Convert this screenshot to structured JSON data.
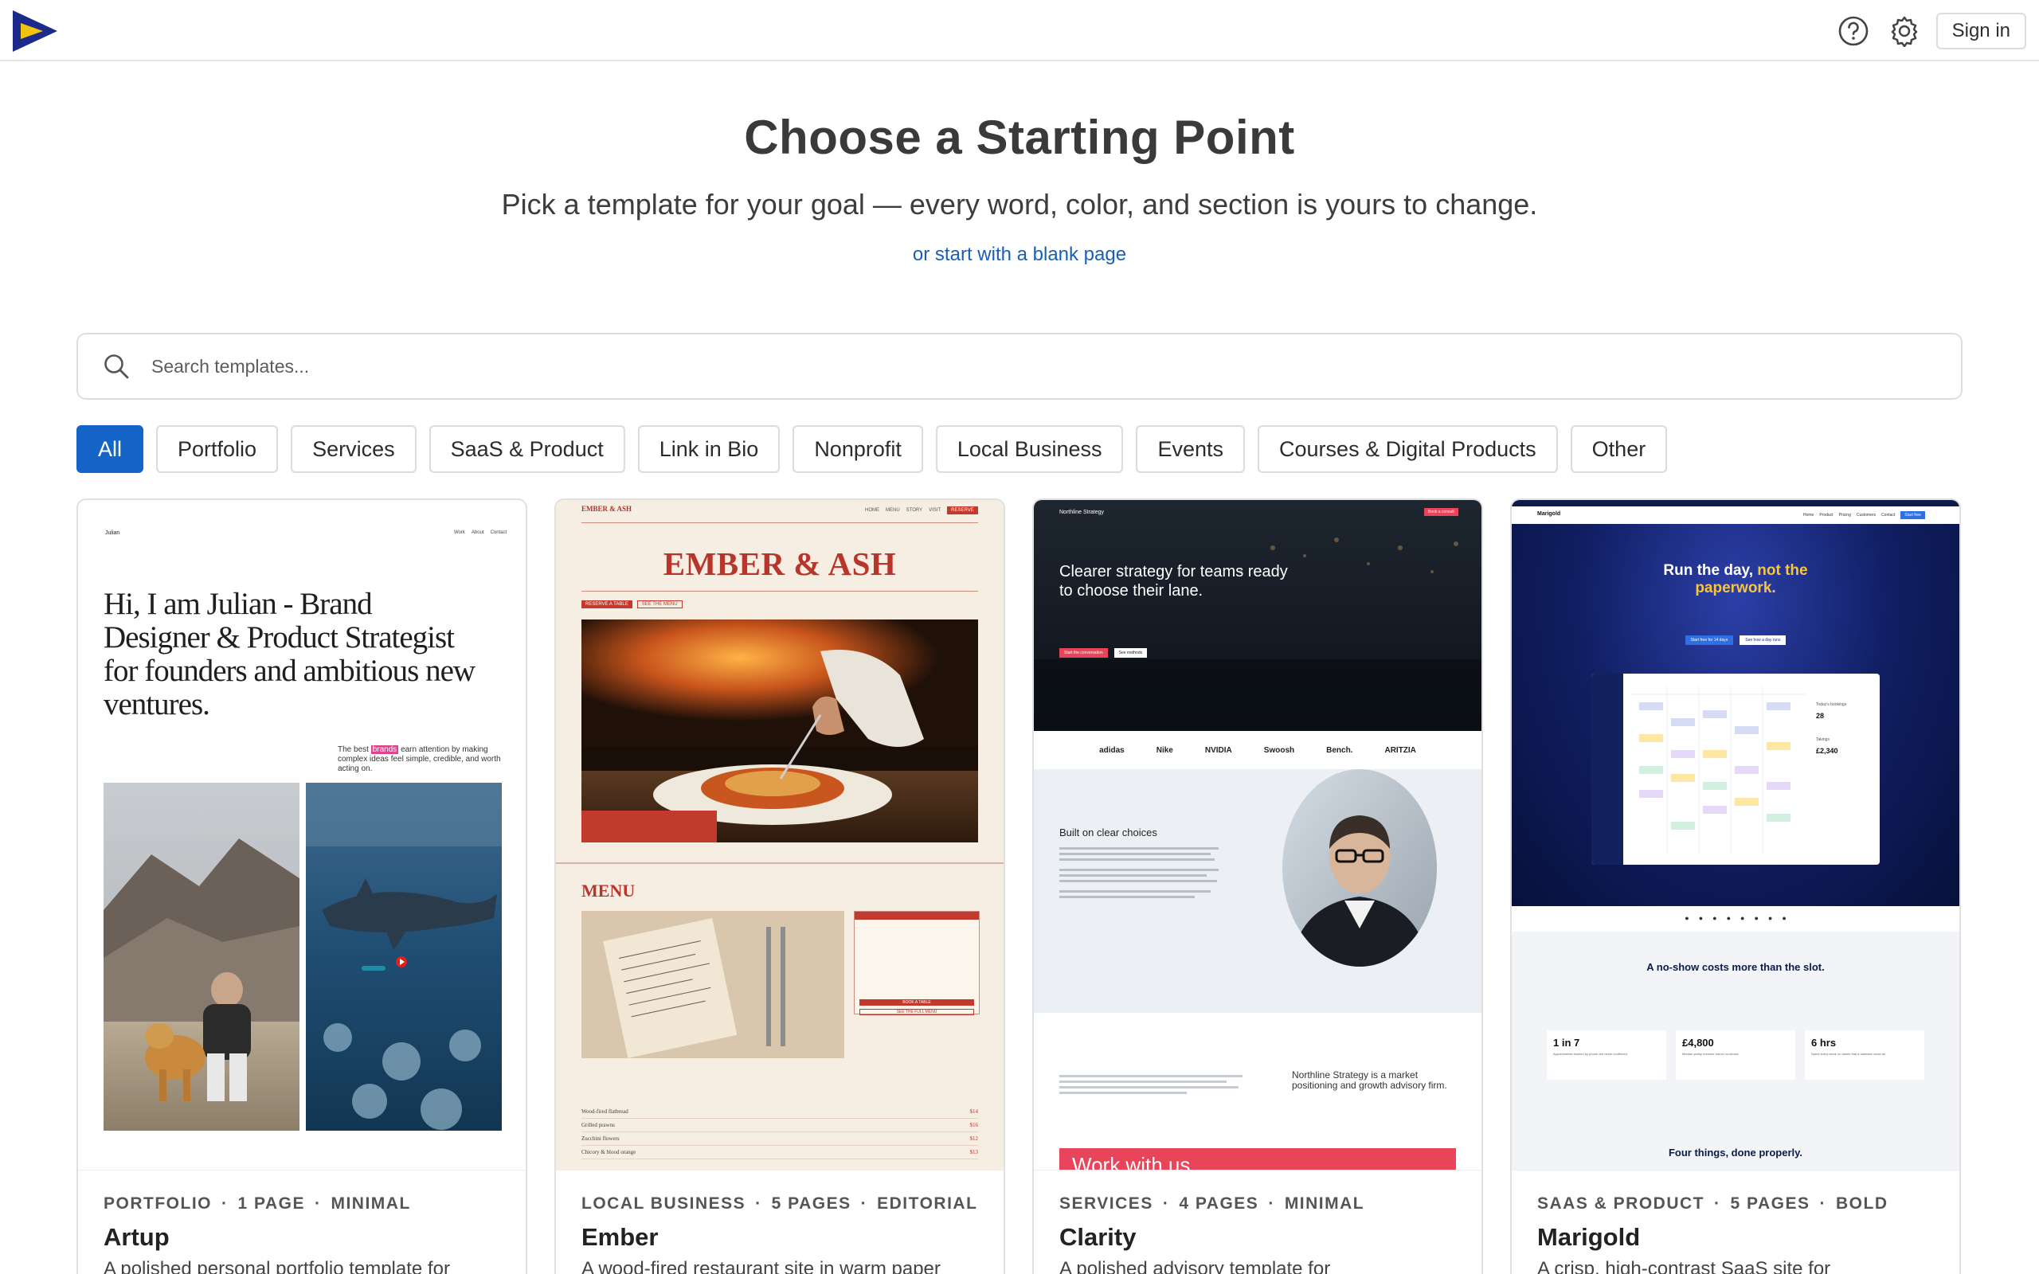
{
  "header": {
    "sign_in_label": "Sign in"
  },
  "hero": {
    "title": "Choose a Starting Point",
    "subtitle": "Pick a template for your goal — every word, color, and section is yours to change.",
    "blank_link": "or start with a blank page"
  },
  "search": {
    "placeholder": "Search templates..."
  },
  "filters": [
    "All",
    "Portfolio",
    "Services",
    "SaaS & Product",
    "Link in Bio",
    "Nonprofit",
    "Local Business",
    "Events",
    "Courses & Digital Products",
    "Other"
  ],
  "active_filter": "All",
  "cards": [
    {
      "category": "PORTFOLIO",
      "pages": "1 PAGE",
      "style": "MINIMAL",
      "name": "Artup",
      "description": "A polished personal portfolio template for",
      "preview": {
        "brand": "Julian",
        "nav": [
          "Work",
          "About",
          "Contact"
        ],
        "headline": "Hi, I am Julian - Brand Designer & Product Strategist for founders and ambitious new ventures.",
        "blurb_before": "The best",
        "blurb_highlight": "brands",
        "blurb_after": "earn attention by making complex ideas feel simple, credible, and worth acting on."
      }
    },
    {
      "category": "LOCAL BUSINESS",
      "pages": "5 PAGES",
      "style": "EDITORIAL",
      "name": "Ember",
      "description": "A wood-fired restaurant site in warm paper",
      "preview": {
        "brand": "EMBER & ASH",
        "nav": [
          "HOME",
          "MENU",
          "STORY",
          "VISIT"
        ],
        "nav_cta": "RESERVE",
        "hero_title": "EMBER & ASH",
        "tags": [
          "RESERVE A TABLE",
          "SEE THE MENU"
        ],
        "menu_title": "MENU",
        "card_button": "BOOK A TABLE",
        "card_link": "SEE THE FULL MENU",
        "menu_items": [
          {
            "name": "Wood-fired flatbread",
            "price": "$14"
          },
          {
            "name": "Grilled prawns",
            "price": "$16"
          },
          {
            "name": "Zucchini flowers",
            "price": "$12"
          },
          {
            "name": "Chicory & blood orange",
            "price": "$13"
          }
        ]
      }
    },
    {
      "category": "SERVICES",
      "pages": "4 PAGES",
      "style": "MINIMAL",
      "name": "Clarity",
      "description": "A polished advisory template for",
      "preview": {
        "brand": "Northline Strategy",
        "cta": "Book a consult",
        "headline": "Clearer strategy for teams ready to choose their lane.",
        "btn_primary": "Start the conversation",
        "btn_secondary": "See methods",
        "logos": [
          "adidas",
          "Nike",
          "NVIDIA",
          "Swoosh",
          "Bench.",
          "ARITZIA"
        ],
        "section_title": "Built on clear choices",
        "about": "Northline Strategy is a market positioning and growth advisory firm.",
        "banner": "Work with us"
      }
    },
    {
      "category": "SAAS & PRODUCT",
      "pages": "5 PAGES",
      "style": "BOLD",
      "name": "Marigold",
      "description": "A crisp, high-contrast SaaS site for",
      "preview": {
        "brand": "Marigold",
        "nav": [
          "Home",
          "Product",
          "Pricing",
          "Customers",
          "Contact"
        ],
        "nav_cta": "Start free",
        "headline_white": "Run the day, ",
        "headline_yellow": "not the",
        "headline_yellow2": "paperwork.",
        "btn_primary": "Start free for 14 days",
        "btn_secondary": "See how a day runs",
        "section_title": "A no-show costs more than the slot.",
        "stats": [
          {
            "value": "1 in 7",
            "label": "Appointments booked by phone are never confirmed"
          },
          {
            "value": "£4,800",
            "label": "Median yearly revenue lost to no-shows"
          },
          {
            "value": "6 hrs",
            "label": "Spent every week on admin that a calendar could do"
          }
        ],
        "bottom_title": "Four things, done properly.",
        "dash_stats": [
          {
            "label": "Today's bookings",
            "value": "28"
          },
          {
            "label": "Takings",
            "value": "£2,340"
          }
        ]
      }
    }
  ]
}
